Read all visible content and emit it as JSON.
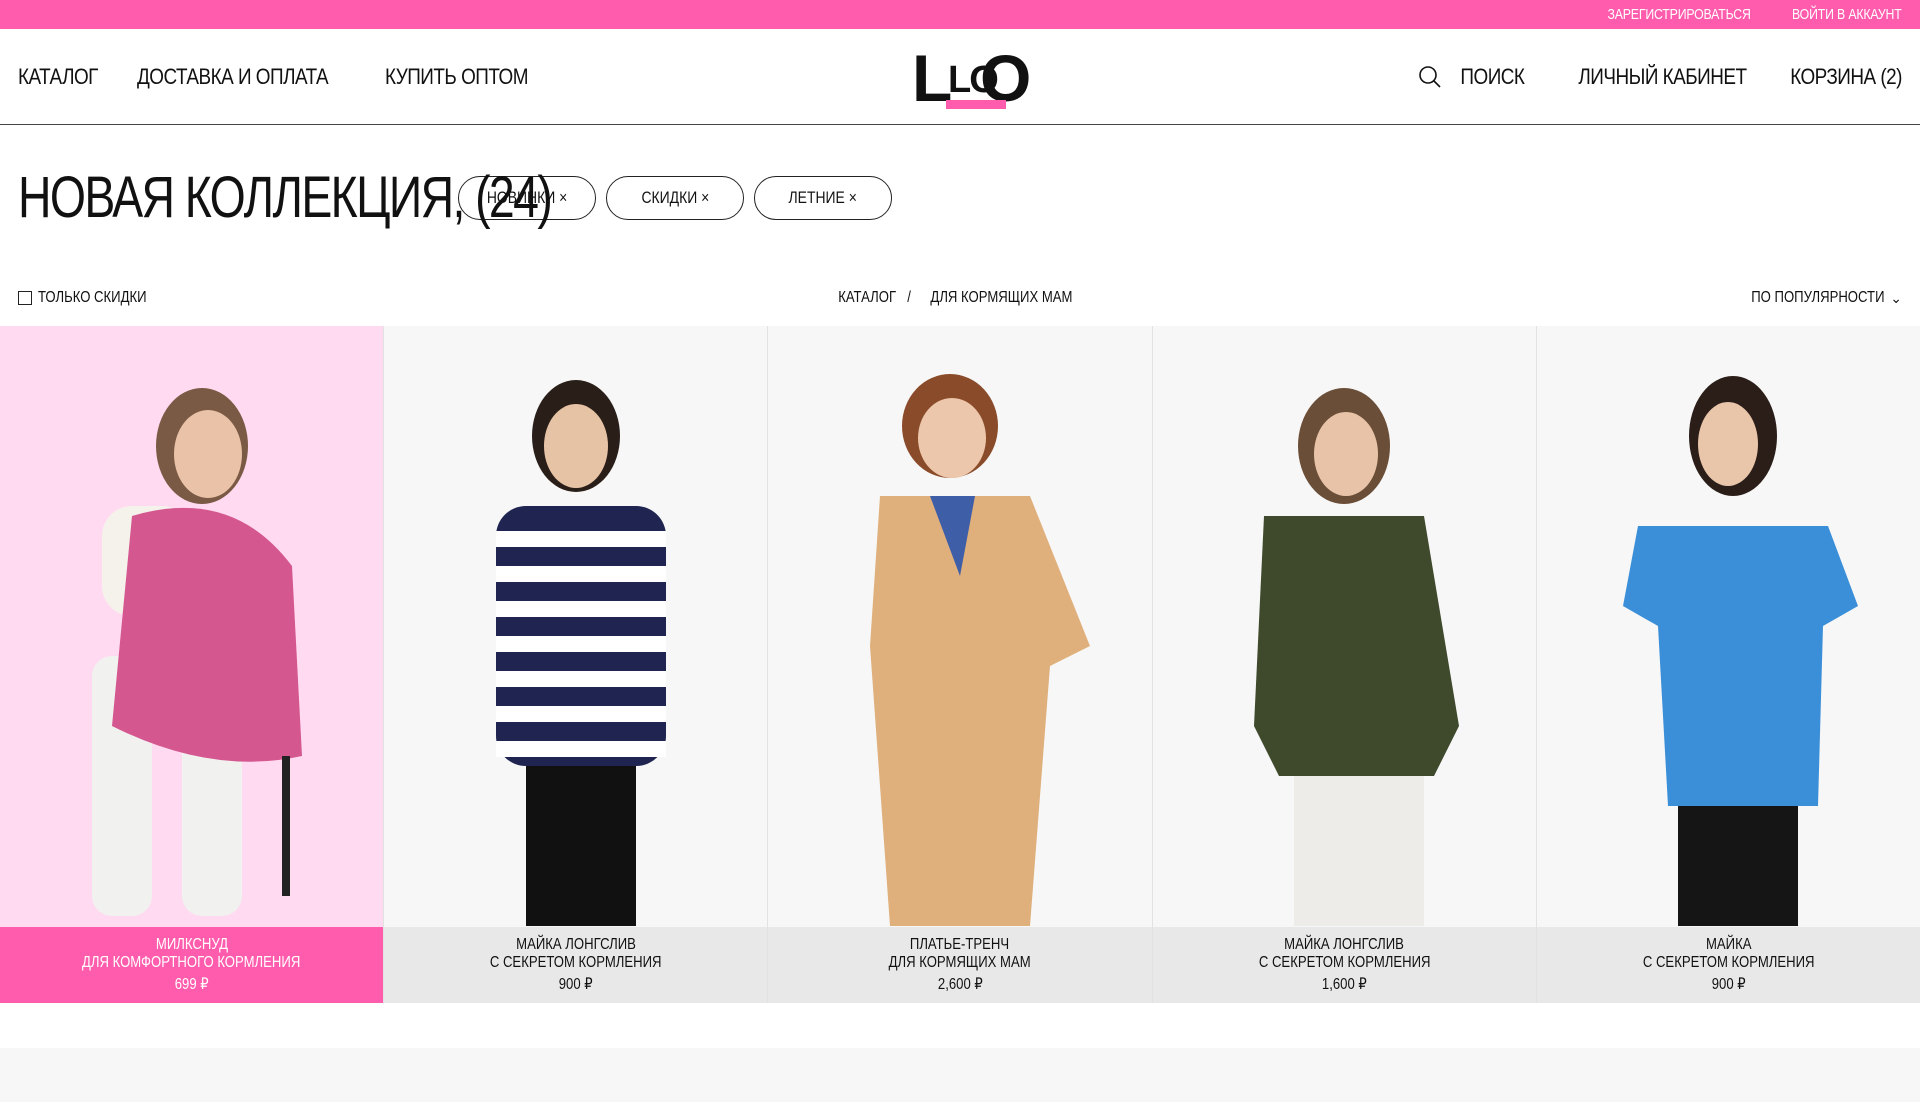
{
  "topbar": {
    "register": "ЗАРЕГИСТРИРОВАТЬСЯ",
    "login": "ВОЙТИ В АККАУНТ"
  },
  "nav": {
    "catalog": "КАТАЛОГ",
    "delivery": "ДОСТАВКА И ОПЛАТА",
    "wholesale": "КУПИТЬ ОПТОМ"
  },
  "logo": {
    "text": "LOLO"
  },
  "header_right": {
    "search": "ПОИСК",
    "account": "ЛИЧНЫЙ КАБИНЕТ",
    "cart": "КОРЗИНА (2)"
  },
  "page": {
    "title": "НОВАЯ КОЛЛЕКЦИЯ, (24)"
  },
  "chips": [
    {
      "label": "НОВИНКИ ×"
    },
    {
      "label": "СКИДКИ ×"
    },
    {
      "label": "ЛЕТНИЕ ×"
    }
  ],
  "filters": {
    "only_discounts": "ТОЛЬКО СКИДКИ",
    "sort": "ПО ПОПУЛЯРНОСТИ",
    "sort_arrow": "⌄"
  },
  "breadcrumb": {
    "root": "КАТАЛОГ",
    "sep": "/",
    "current": "ДЛЯ КОРМЯЩИХ МАМ"
  },
  "products": [
    {
      "name1": "МИЛКСНУД",
      "name2": "ДЛЯ КОМФОРТНОГО КОРМЛЕНИЯ",
      "price": "699 ₽",
      "garment_color": "#d4588f",
      "active": true
    },
    {
      "name1": "МАЙКА ЛОНГСЛИВ",
      "name2": "С СЕКРЕТОМ КОРМЛЕНИЯ",
      "price": "900 ₽",
      "garment_color": "#1f2550",
      "active": false
    },
    {
      "name1": "ПЛАТЬЕ-ТРЕНЧ",
      "name2": "ДЛЯ КОРМЯЩИХ МАМ",
      "price": "2,600 ₽",
      "garment_color": "#e0b07c",
      "active": false
    },
    {
      "name1": "МАЙКА ЛОНГСЛИВ",
      "name2": "С СЕКРЕТОМ КОРМЛЕНИЯ",
      "price": "1,600 ₽",
      "garment_color": "#3f4a2c",
      "active": false
    },
    {
      "name1": "МАЙКА",
      "name2": "С СЕКРЕТОМ КОРМЛЕНИЯ",
      "price": "900 ₽",
      "garment_color": "#3a8fd8",
      "active": false
    }
  ]
}
